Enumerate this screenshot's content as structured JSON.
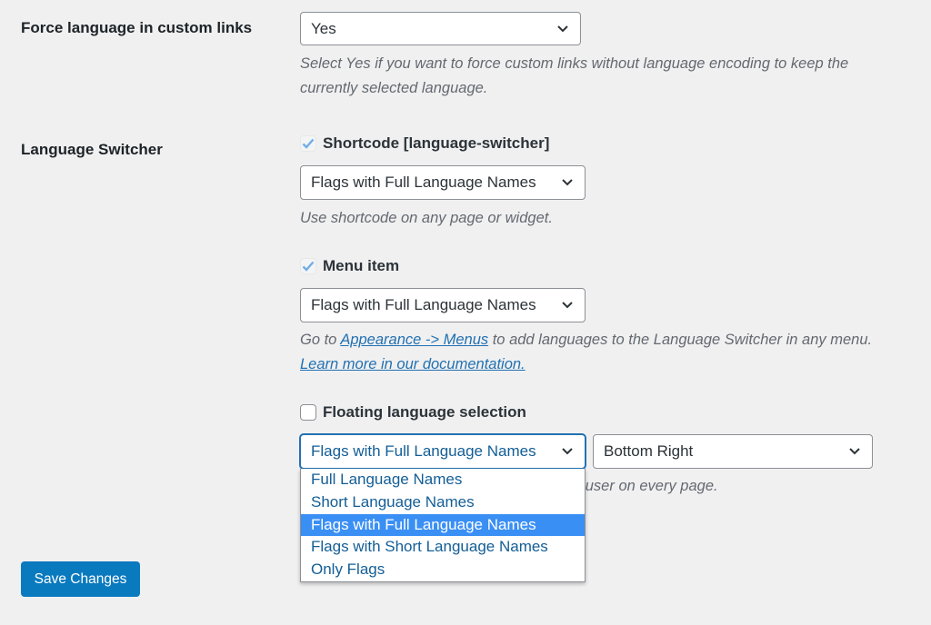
{
  "force_language": {
    "label": "Force language in custom links",
    "select_value": "Yes",
    "description": "Select Yes if you want to force custom links without language encoding to keep the currently selected language."
  },
  "language_switcher": {
    "label": "Language Switcher",
    "shortcode": {
      "checkbox_label": "Shortcode [language-switcher]",
      "checked": true,
      "select_value": "Flags with Full Language Names",
      "description": "Use shortcode on any page or widget."
    },
    "menu_item": {
      "checkbox_label": "Menu item",
      "checked": true,
      "select_value": "Flags with Full Language Names",
      "description_prefix": "Go to ",
      "description_link": "Appearance -> Menus",
      "description_suffix": " to add languages to the Language Switcher in any menu.",
      "doc_link": "Learn more in our documentation."
    },
    "floating": {
      "checkbox_label": "Floating language selection",
      "checked": false,
      "select_value": "Flags with Full Language Names",
      "position_value": "Bottom Right",
      "description_visible": "e user on every page.",
      "dropdown_open": true,
      "options": [
        "Full Language Names",
        "Short Language Names",
        "Flags with Full Language Names",
        "Flags with Short Language Names",
        "Only Flags"
      ],
      "selected_index": 2
    }
  },
  "save_button": {
    "label": "Save Changes"
  },
  "colors": {
    "background": "#f0f0f1",
    "accent": "#2271b1",
    "button": "#0a7abf",
    "option_highlight": "#3a8ff5",
    "checkmark": "#72aee6"
  }
}
